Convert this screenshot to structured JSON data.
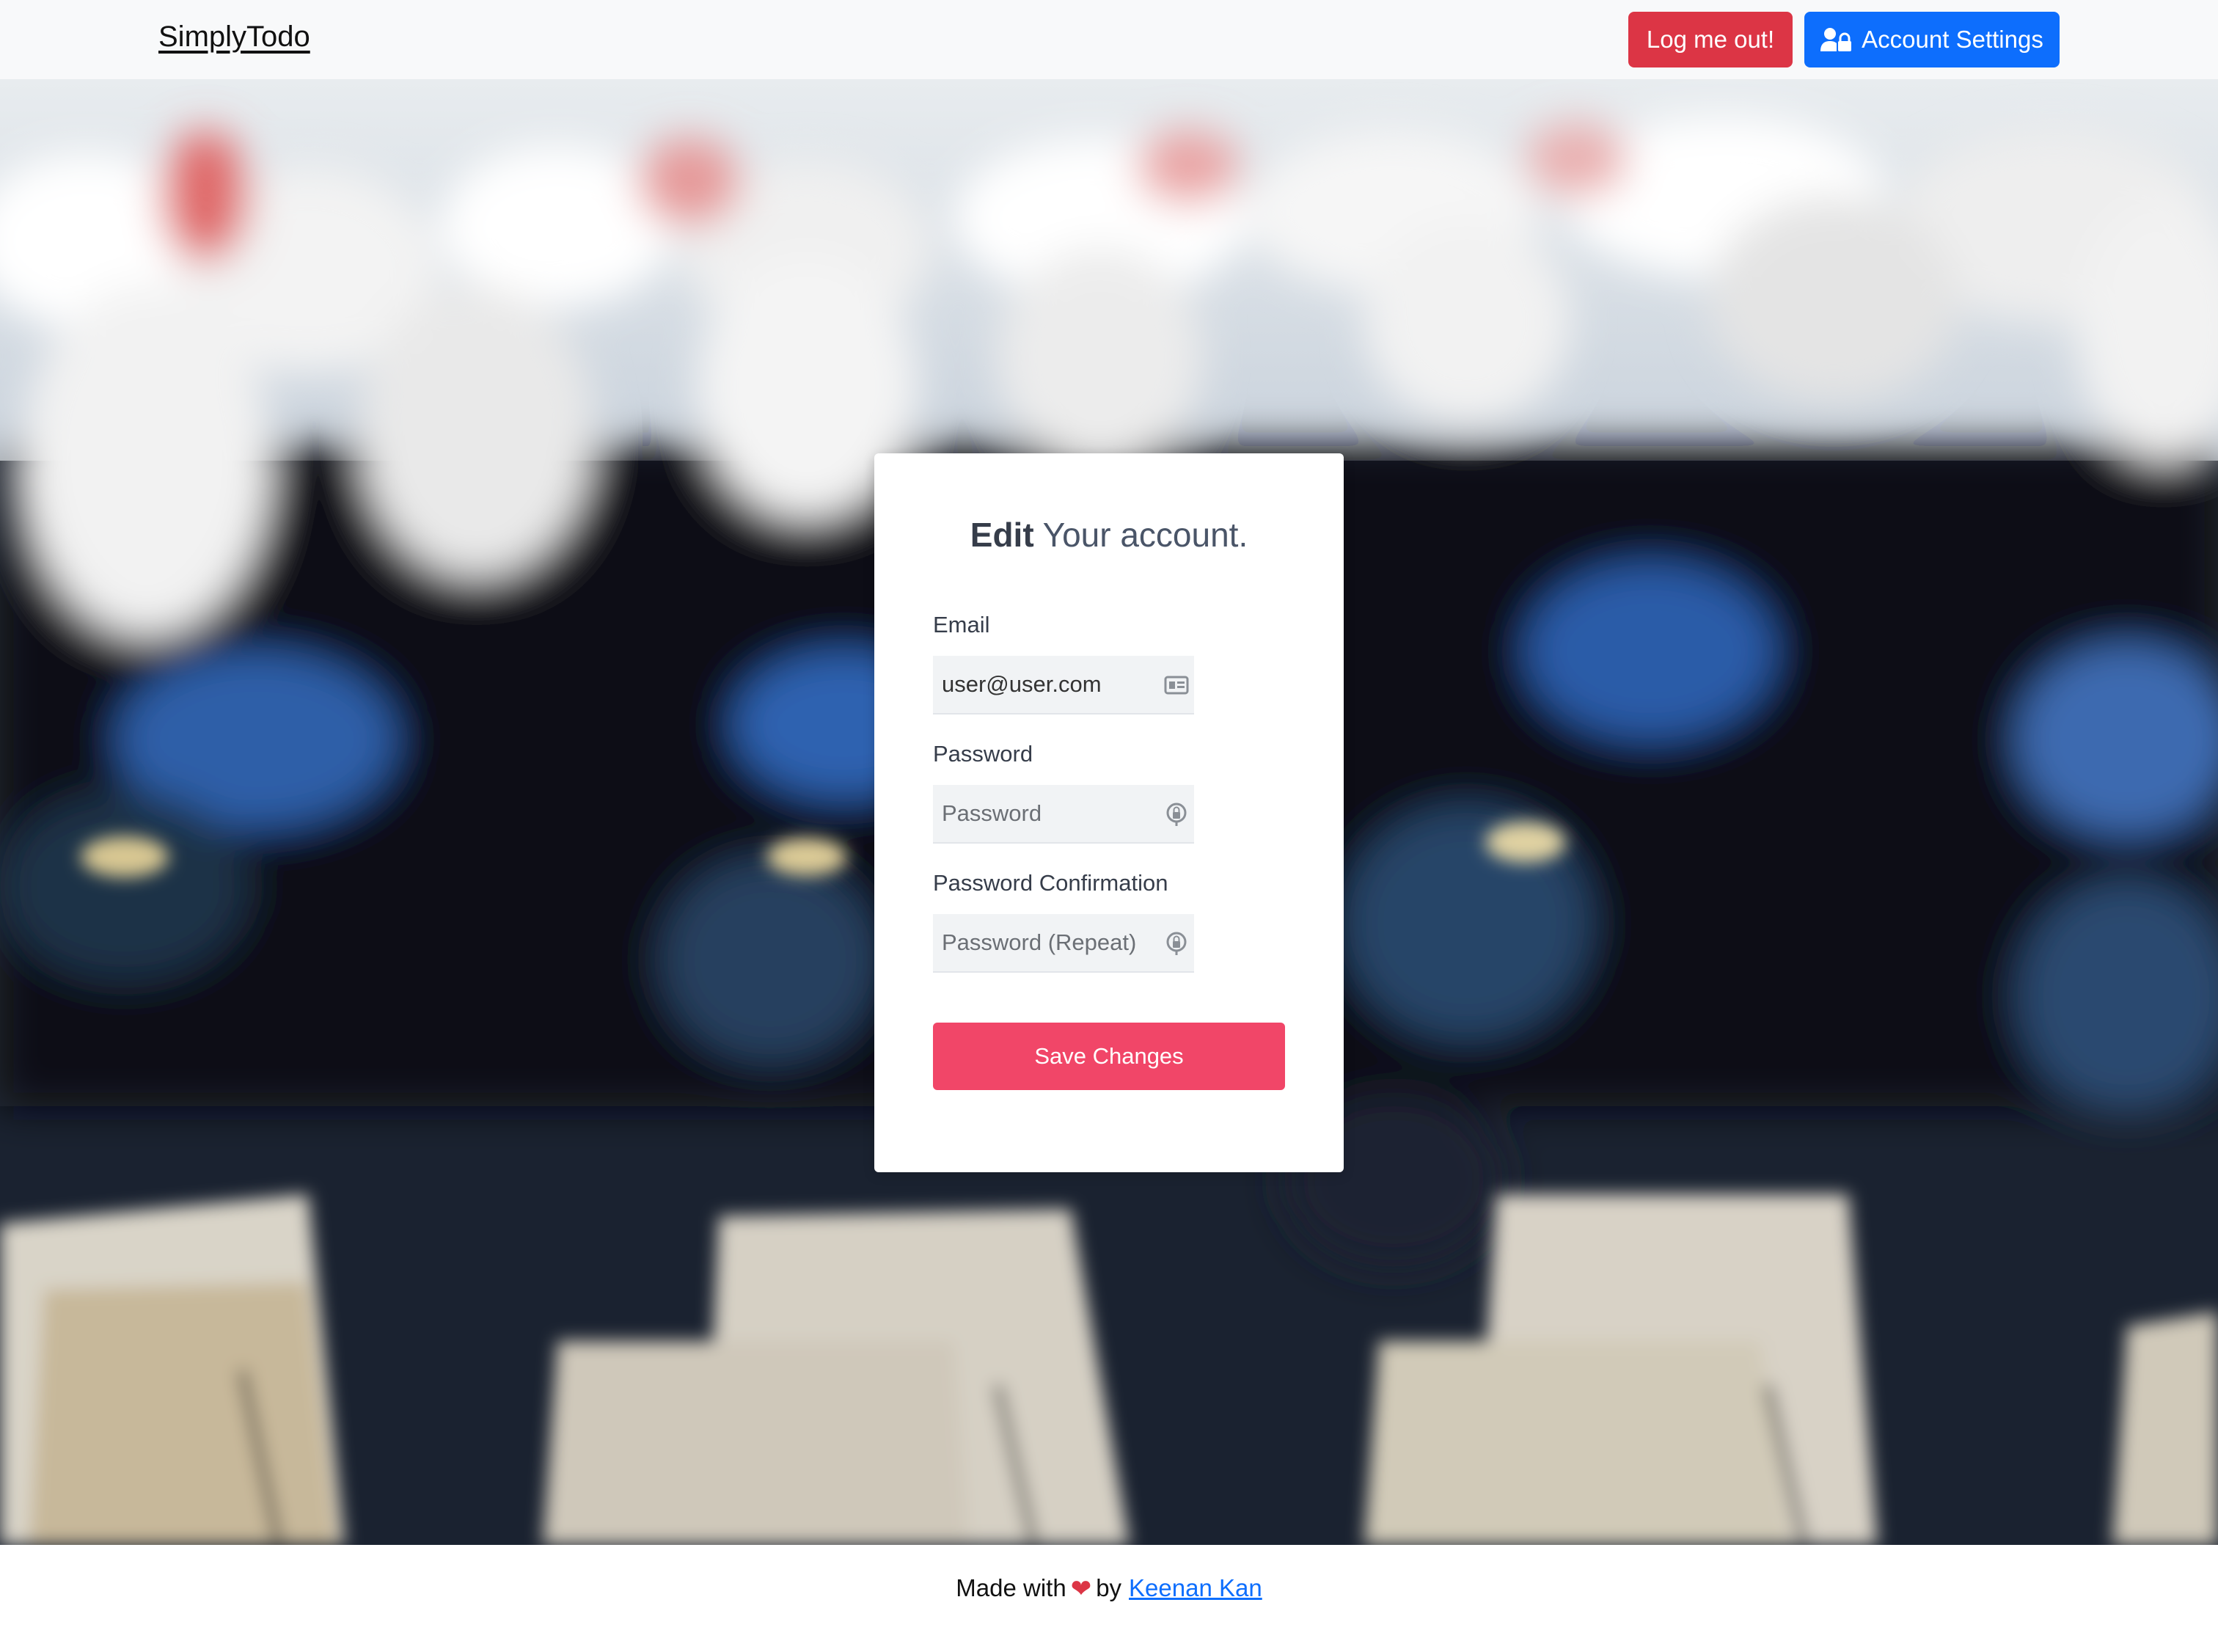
{
  "navbar": {
    "brand": "SimplyTodo",
    "logout_label": "Log me out!",
    "account_settings_label": "Account Settings"
  },
  "form": {
    "title_bold": "Edit",
    "title_rest": "Your account.",
    "email": {
      "label": "Email",
      "value": "user@user.com",
      "icon": "id-card-icon"
    },
    "password": {
      "label": "Password",
      "placeholder": "Password",
      "icon": "lock-icon"
    },
    "password_confirm": {
      "label": "Password Confirmation",
      "placeholder": "Password (Repeat)",
      "icon": "lock-icon"
    },
    "save_label": "Save Changes"
  },
  "footer": {
    "made_with": "Made with",
    "by": "by",
    "author": "Keenan Kan"
  },
  "colors": {
    "logout": "#dc3545",
    "account": "#0d6efd",
    "save": "#f14668",
    "navbar_bg": "#f8f9fa"
  }
}
